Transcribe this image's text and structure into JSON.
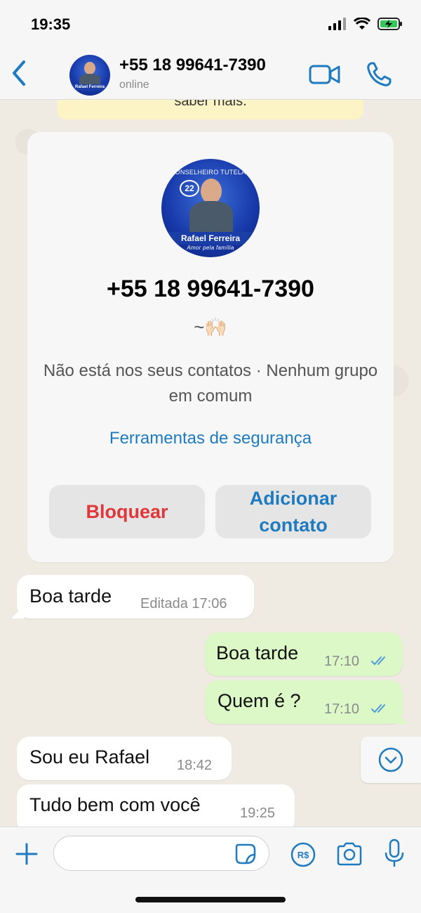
{
  "status_bar": {
    "time": "19:35",
    "icons": [
      "signal-icon",
      "wifi-icon",
      "battery-charging-icon"
    ],
    "battery_color": "#34c759"
  },
  "header": {
    "back_icon": "chevron-left-icon",
    "title": "+55 18 99641-7390",
    "subtitle": "online",
    "video_icon": "video-call-icon",
    "phone_icon": "phone-icon",
    "accent": "#1f7bbf"
  },
  "chat": {
    "notice_partial": "saber mais.",
    "contact_card": {
      "avatar_top_text": "CONSELHEIRO TUTELAR",
      "avatar_badge": "22",
      "avatar_name": "Rafael Ferreira",
      "avatar_tagline": "Amor pela família",
      "phone": "+55 18 99641-7390",
      "status": "~🙌🏻",
      "info": "Não está nos seus contatos · Nenhum grupo em comum",
      "safety_link": "Ferramentas de segurança",
      "block_label": "Bloquear",
      "add_label": "Adicionar contato"
    },
    "messages": [
      {
        "direction": "in",
        "text": "Boa tarde",
        "meta": "Editada 17:06"
      },
      {
        "direction": "out",
        "text": "Boa tarde",
        "meta": "17:10"
      },
      {
        "direction": "out",
        "text": "Quem é ?",
        "meta": "17:10"
      },
      {
        "direction": "in",
        "text": "Sou eu Rafael",
        "meta": "18:42"
      },
      {
        "direction": "in",
        "text": "Tudo bem com você",
        "meta": "19:25"
      }
    ],
    "scroll_icon": "chevron-down-circle-icon"
  },
  "input_bar": {
    "placeholder": "",
    "icons": [
      "plus-icon",
      "sticker-icon",
      "payment-icon",
      "camera-icon",
      "microphone-icon"
    ]
  }
}
